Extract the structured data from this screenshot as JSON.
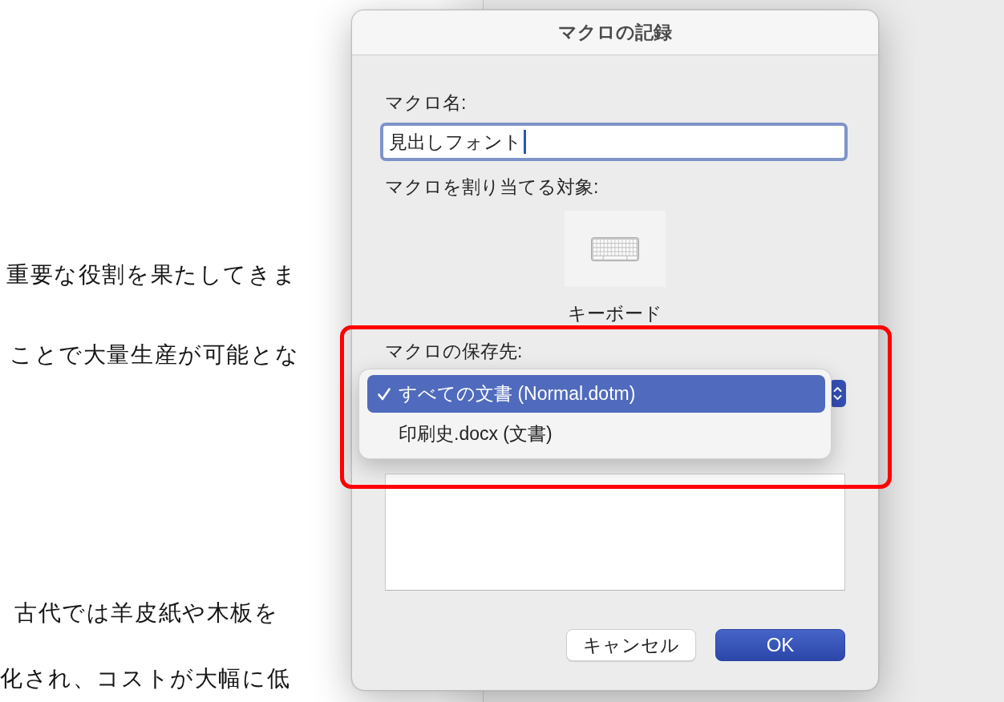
{
  "document": {
    "lines": [
      "重要な役割を果たしてきま",
      "ことで大量生産が可能とな",
      "古代では羊皮紙や木板を",
      "化され、コストが大幅に低"
    ]
  },
  "dialog": {
    "title": "マクロの記録",
    "macro_name": {
      "label": "マクロ名:",
      "value": "見出しフォント",
      "focused": true
    },
    "assign_to": {
      "label": "マクロを割り当てる対象:",
      "options": [
        {
          "label": "キーボード",
          "kind": "keyboard"
        }
      ]
    },
    "store_in": {
      "label": "マクロの保存先:",
      "highlighted": true,
      "menu": [
        {
          "label": "すべての文書 (Normal.dotm)",
          "selected": true
        },
        {
          "label": "印刷史.docx (文書)",
          "selected": false
        }
      ]
    },
    "buttons": [
      {
        "label": "キャンセル",
        "kind": "cancel"
      },
      {
        "label": "OK",
        "kind": "default"
      }
    ]
  }
}
